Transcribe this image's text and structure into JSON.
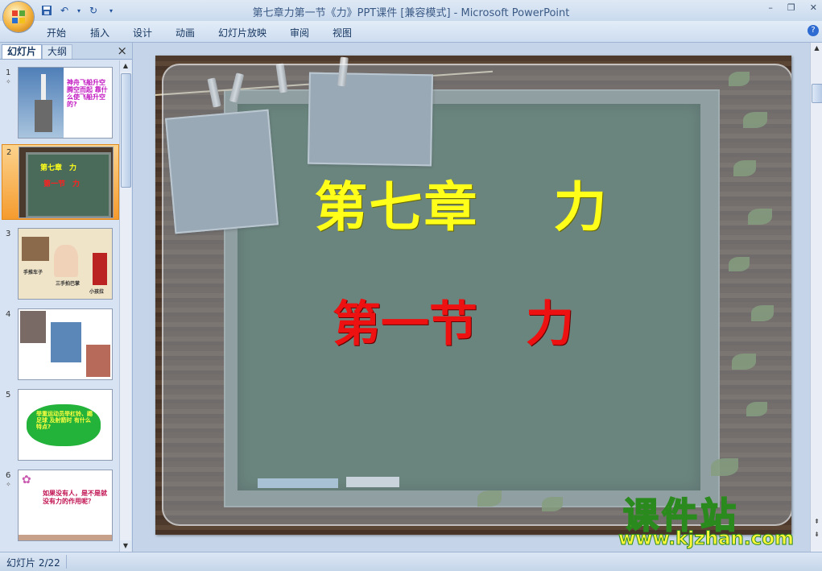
{
  "window": {
    "title": "第七章力第一节《力》PPT课件 [兼容模式] - Microsoft PowerPoint",
    "minimize": "–",
    "restore": "❐",
    "close": "✕"
  },
  "ribbon": {
    "tabs": [
      "开始",
      "插入",
      "设计",
      "动画",
      "幻灯片放映",
      "审阅",
      "视图"
    ]
  },
  "left_pane": {
    "tab_slides": "幻灯片",
    "tab_outline": "大纲",
    "close": "×",
    "thumbnails": [
      {
        "num": "1",
        "text": "神舟飞船升空腾空而起 靠什么使飞船升空的?"
      },
      {
        "num": "2",
        "title": "第七章　力",
        "subtitle": "第一节　力"
      },
      {
        "num": "3",
        "labels": [
          "手推车子",
          "三手拍巴掌",
          "小孩拉"
        ]
      },
      {
        "num": "4"
      },
      {
        "num": "5",
        "text": "举重运动员举杠铃、踢足球 及射箭时 有什么特点?"
      },
      {
        "num": "6",
        "text": "如果没有人，是不是就没有力的作用呢？"
      }
    ]
  },
  "slide": {
    "title": "第七章　 力",
    "subtitle": "第一节　力"
  },
  "watermark": {
    "brand": "课件站",
    "url": "www.kjzhan.com"
  },
  "status": {
    "slide_counter": "幻灯片 2/22"
  },
  "colors": {
    "title_yellow": "#ffff1a",
    "subtitle_red": "#ee1111",
    "selected_thumb": "#f59b2e"
  }
}
